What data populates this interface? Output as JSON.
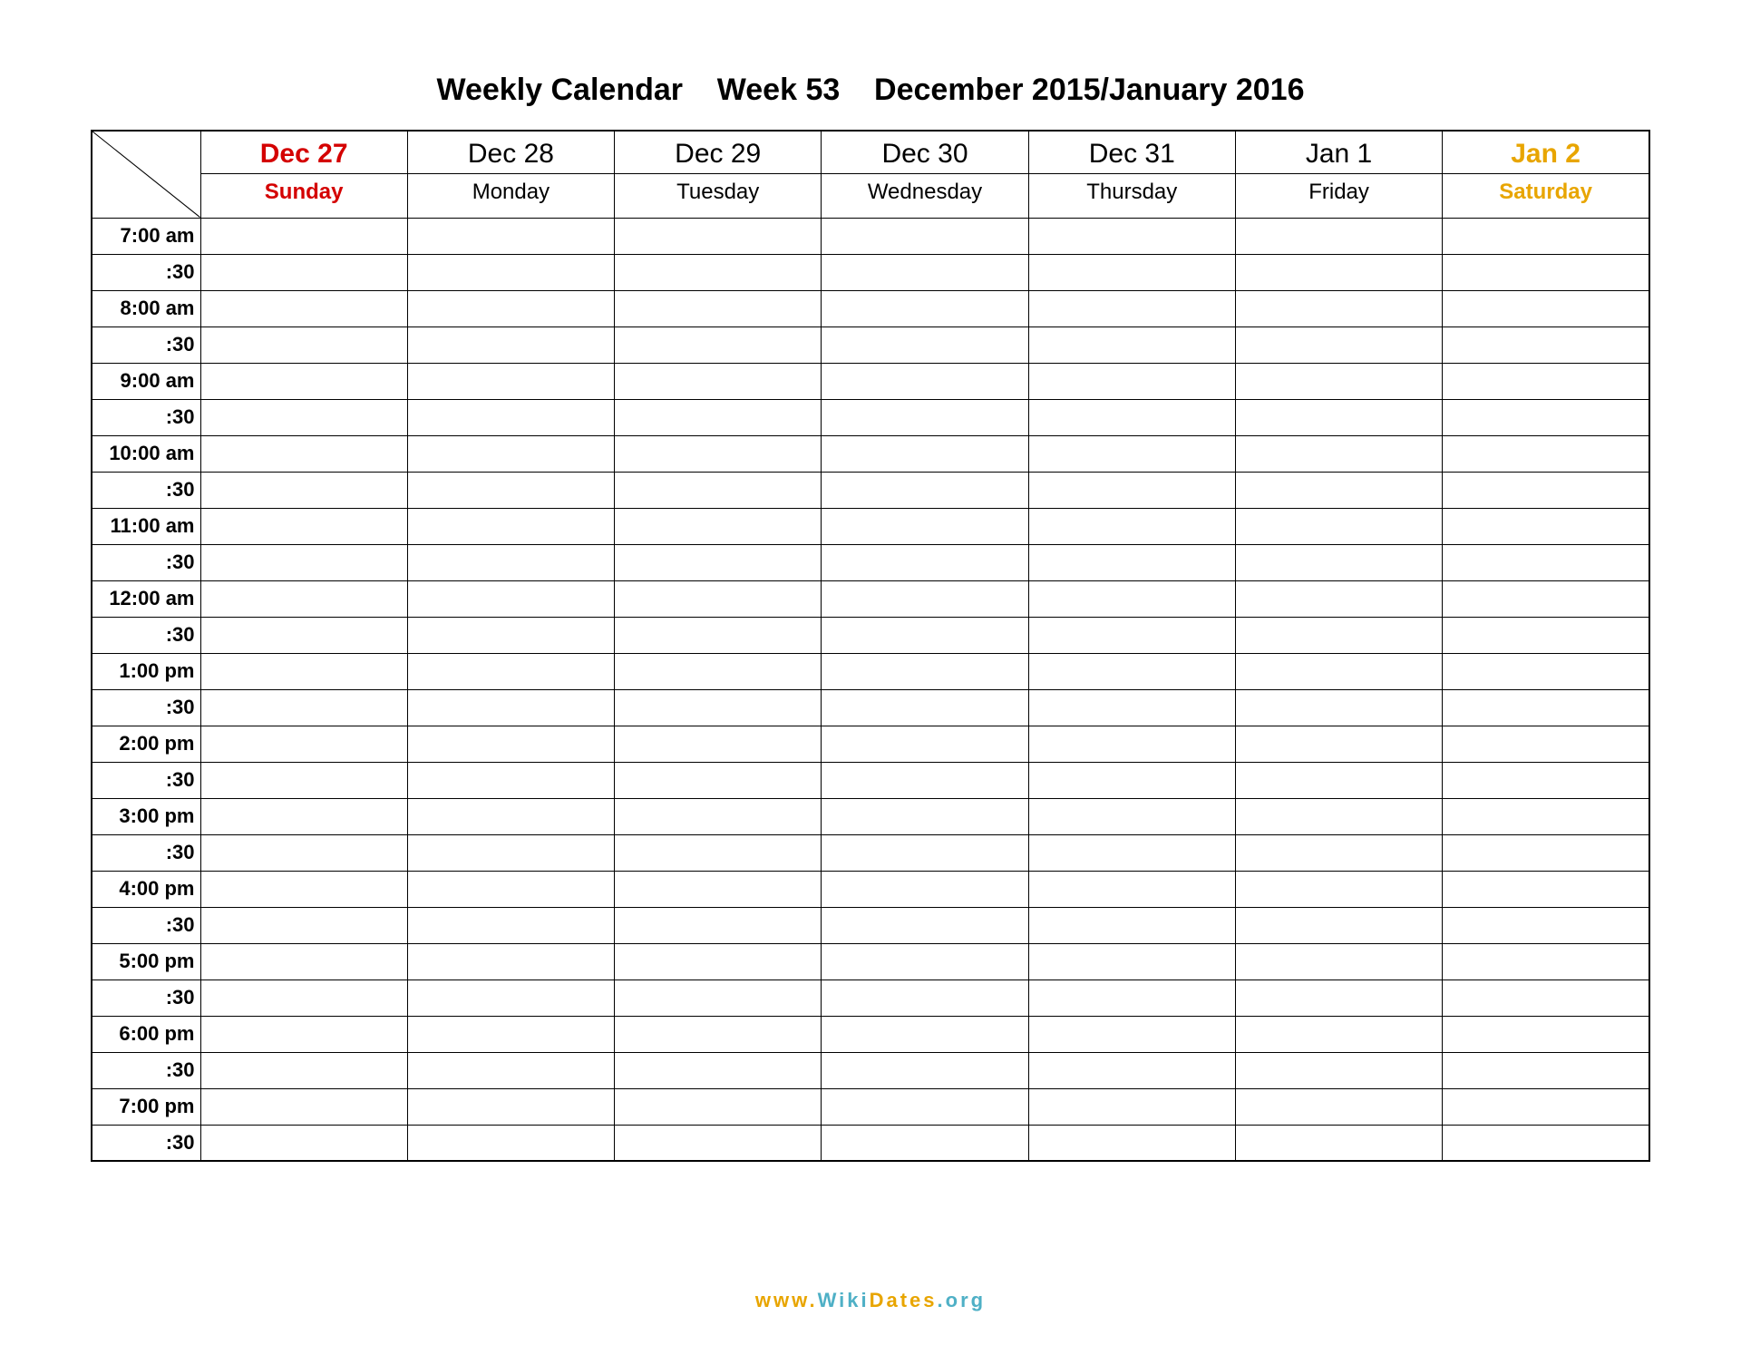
{
  "title": "Weekly Calendar    Week 53    December 2015/January 2016",
  "days": [
    {
      "date": "Dec 27",
      "dow": "Sunday",
      "class": "sunday"
    },
    {
      "date": "Dec 28",
      "dow": "Monday",
      "class": ""
    },
    {
      "date": "Dec 29",
      "dow": "Tuesday",
      "class": ""
    },
    {
      "date": "Dec 30",
      "dow": "Wednesday",
      "class": ""
    },
    {
      "date": "Dec 31",
      "dow": "Thursday",
      "class": ""
    },
    {
      "date": "Jan 1",
      "dow": "Friday",
      "class": ""
    },
    {
      "date": "Jan 2",
      "dow": "Saturday",
      "class": "saturday"
    }
  ],
  "times": [
    "7:00 am",
    ":30",
    "8:00 am",
    ":30",
    "9:00 am",
    ":30",
    "10:00 am",
    ":30",
    "11:00 am",
    ":30",
    "12:00 am",
    ":30",
    "1:00 pm",
    ":30",
    "2:00 pm",
    ":30",
    "3:00 pm",
    ":30",
    "4:00 pm",
    ":30",
    "5:00 pm",
    ":30",
    "6:00 pm",
    ":30",
    "7:00 pm",
    ":30"
  ],
  "footer": {
    "www": "www.",
    "wiki": "Wiki",
    "dates": "Dates",
    "org": ".org"
  },
  "colors": {
    "sunday": "#d40000",
    "saturday": "#e8a500",
    "accent_teal": "#4fb0c6",
    "accent_gold": "#e8a500"
  }
}
